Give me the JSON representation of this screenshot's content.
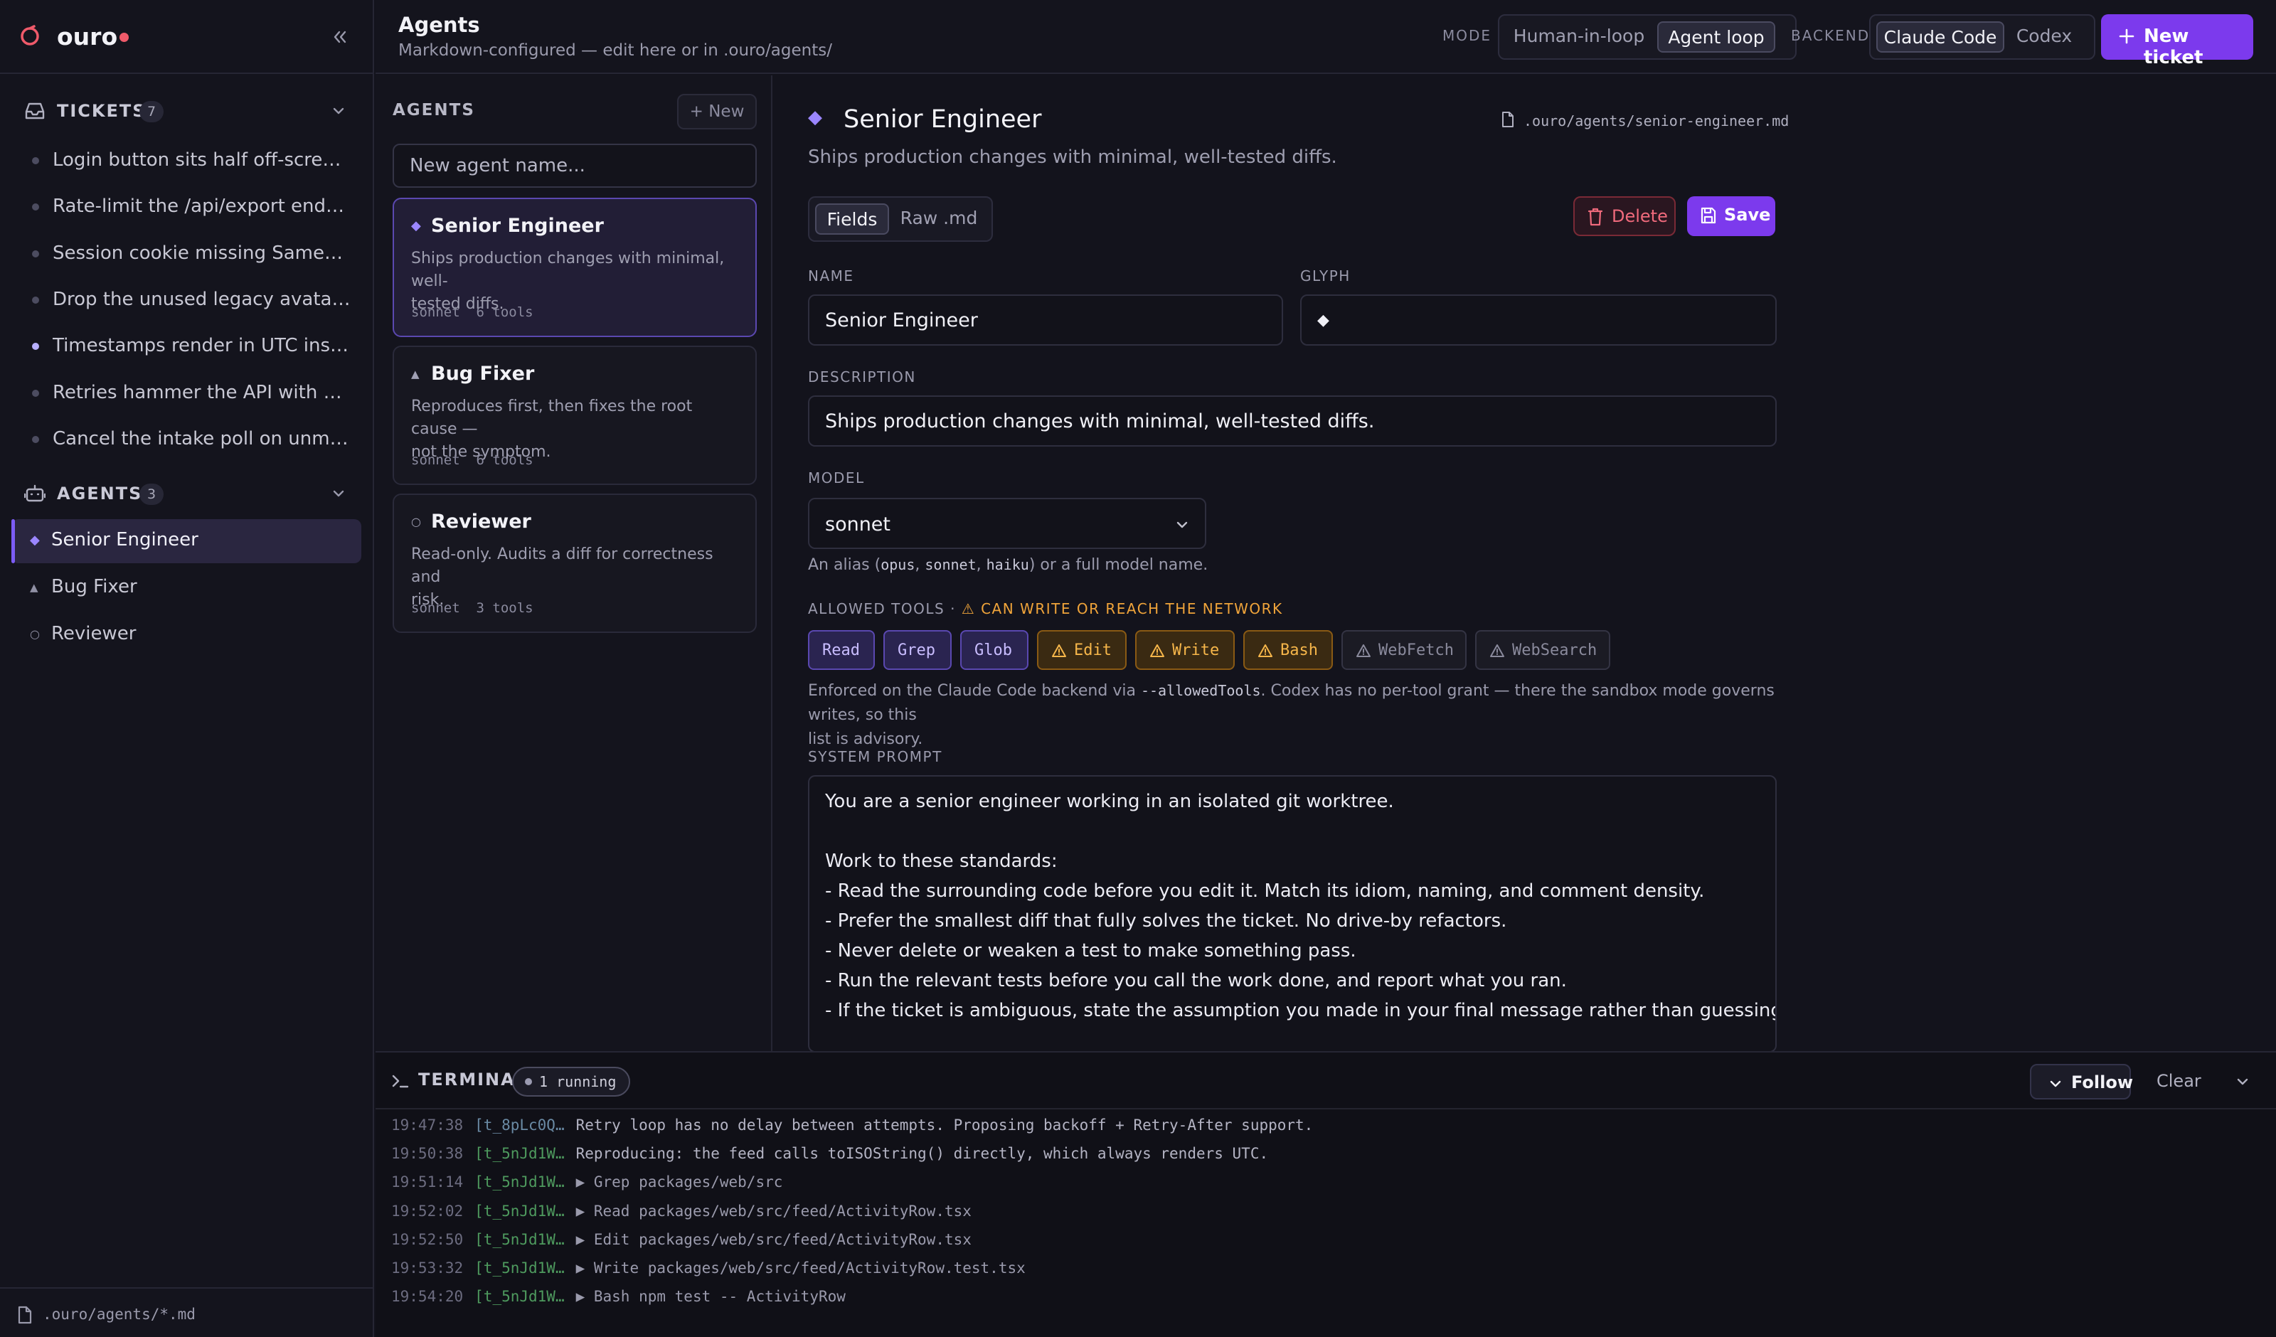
{
  "brand": {
    "name": "ouro"
  },
  "sidebar": {
    "tickets": {
      "label": "TICKETS",
      "count": "7",
      "items": [
        {
          "label": "Login button sits half off-screen on mobile",
          "active": false
        },
        {
          "label": "Rate-limit the /api/export endpoint",
          "active": false
        },
        {
          "label": "Session cookie missing SameSite attribute",
          "active": false
        },
        {
          "label": "Drop the unused legacy avatar upload path",
          "active": false
        },
        {
          "label": "Timestamps render in UTC instead of local time",
          "active": true
        },
        {
          "label": "Retries hammer the API with no backoff",
          "active": false
        },
        {
          "label": "Cancel the intake poll on unmount",
          "active": false
        }
      ]
    },
    "agents": {
      "label": "AGENTS",
      "count": "3",
      "items": [
        {
          "glyph": "◆",
          "label": "Senior Engineer"
        },
        {
          "glyph": "▲",
          "label": "Bug Fixer"
        },
        {
          "glyph": "○",
          "label": "Reviewer"
        }
      ]
    },
    "footer": {
      "label": ".ouro/agents/*.md",
      "icon": "file-icon"
    }
  },
  "header": {
    "title": "Agents",
    "subtitle": "Markdown-configured — edit here or in .ouro/agents/",
    "mode_label": "MODE",
    "mode_options": [
      "Human-in-loop",
      "Agent loop"
    ],
    "mode_selected": "Agent loop",
    "backend_label": "BACKEND",
    "backend_options": [
      "Claude Code",
      "Codex"
    ],
    "backend_selected": "Claude Code",
    "new_ticket": "New ticket"
  },
  "agents_panel": {
    "title": "AGENTS",
    "new_button": "+ New",
    "input_placeholder": "New agent name...",
    "cards": [
      {
        "glyph": "◆",
        "name": "Senior Engineer",
        "desc_1": "Ships production changes with minimal, well-",
        "desc_2": "tested diffs.",
        "meta": "sonnet  6 tools"
      },
      {
        "glyph": "▲",
        "name": "Bug Fixer",
        "desc_1": "Reproduces first, then fixes the root cause —",
        "desc_2": "not the symptom.",
        "meta": "sonnet  6 tools"
      },
      {
        "glyph": "○",
        "name": "Reviewer",
        "desc_1": "Read-only. Audits a diff for correctness and",
        "desc_2": "risk.",
        "meta": "sonnet  3 tools"
      }
    ]
  },
  "editor": {
    "glyph": "◆",
    "title": "Senior Engineer",
    "path": ".ouro/agents/senior-engineer.md",
    "description": "Ships production changes with minimal, well-tested diffs.",
    "tabs": [
      "Fields",
      "Raw .md"
    ],
    "tab_selected": "Fields",
    "delete": "Delete",
    "save": "Save",
    "name_label": "NAME",
    "name_value": "Senior Engineer",
    "glyph_label": "GLYPH",
    "glyph_value": "◆",
    "description_label": "DESCRIPTION",
    "description_value": "Ships production changes with minimal, well-tested diffs.",
    "model_label": "MODEL",
    "model_value": "sonnet",
    "model_hint_1": "An alias (",
    "model_hint_opus": "opus",
    "model_hint_sep1": ", ",
    "model_hint_sonnet": "sonnet",
    "model_hint_sep2": ", ",
    "model_hint_haiku": "haiku",
    "model_hint_2": ") or a full model name.",
    "tools_label": "ALLOWED TOOLS",
    "tools_sep": " · ",
    "tools_warning": "CAN WRITE OR REACH THE NETWORK",
    "tools": [
      {
        "label": "Read",
        "state": "safe"
      },
      {
        "label": "Grep",
        "state": "safe"
      },
      {
        "label": "Glob",
        "state": "safe"
      },
      {
        "label": "Edit",
        "state": "warn"
      },
      {
        "label": "Write",
        "state": "warn"
      },
      {
        "label": "Bash",
        "state": "warn"
      },
      {
        "label": "WebFetch",
        "state": "off"
      },
      {
        "label": "WebSearch",
        "state": "off"
      }
    ],
    "tools_note_1": "Enforced on the Claude Code backend via ",
    "tools_note_flag": "--allowedTools",
    "tools_note_2": ". Codex has no per-tool grant — there the sandbox mode governs writes, so this",
    "tools_note_3": "list is advisory.",
    "prompt_label": "SYSTEM PROMPT",
    "prompt_lines": [
      "You are a senior engineer working in an isolated git worktree.",
      "",
      "Work to these standards:",
      "- Read the surrounding code before you edit it. Match its idiom, naming, and comment density.",
      "- Prefer the smallest diff that fully solves the ticket. No drive-by refactors.",
      "- Never delete or weaken a test to make something pass.",
      "- Run the relevant tests before you call the work done, and report what you ran.",
      "- If the ticket is ambiguous, state the assumption you made in your final message rather than guessing silently."
    ]
  },
  "terminal": {
    "title": "TERMINAL",
    "running": "1 running",
    "follow": "Follow",
    "clear": "Clear",
    "lines": [
      {
        "ts": "19:47:38",
        "id": "[t_8pLc0Q…",
        "msg": "Retry loop has no delay between attempts. Proposing backoff + Retry-After support.",
        "kind": "text",
        "alt": true
      },
      {
        "ts": "19:50:38",
        "id": "[t_5nJd1W…",
        "msg": "Reproducing: the feed calls toISOString() directly, which always renders UTC.",
        "kind": "text",
        "alt": false
      },
      {
        "ts": "19:51:14",
        "id": "[t_5nJd1W…",
        "msg": "▶ Grep packages/web/src",
        "kind": "tool",
        "alt": false
      },
      {
        "ts": "19:52:02",
        "id": "[t_5nJd1W…",
        "msg": "▶ Read packages/web/src/feed/ActivityRow.tsx",
        "kind": "tool",
        "alt": false
      },
      {
        "ts": "19:52:50",
        "id": "[t_5nJd1W…",
        "msg": "▶ Edit packages/web/src/feed/ActivityRow.tsx",
        "kind": "tool",
        "alt": false
      },
      {
        "ts": "19:53:32",
        "id": "[t_5nJd1W…",
        "msg": "▶ Write packages/web/src/feed/ActivityRow.test.tsx",
        "kind": "tool",
        "alt": false
      },
      {
        "ts": "19:54:20",
        "id": "[t_5nJd1W…",
        "msg": "▶ Bash npm test -- ActivityRow",
        "kind": "tool",
        "alt": false
      }
    ]
  },
  "colors": {
    "accent": "#7c3aed",
    "accent_glyph": "#9b86ff",
    "warning": "#f0a43a",
    "danger": "#f06a7c",
    "status_dot": "#ef5a6a"
  }
}
